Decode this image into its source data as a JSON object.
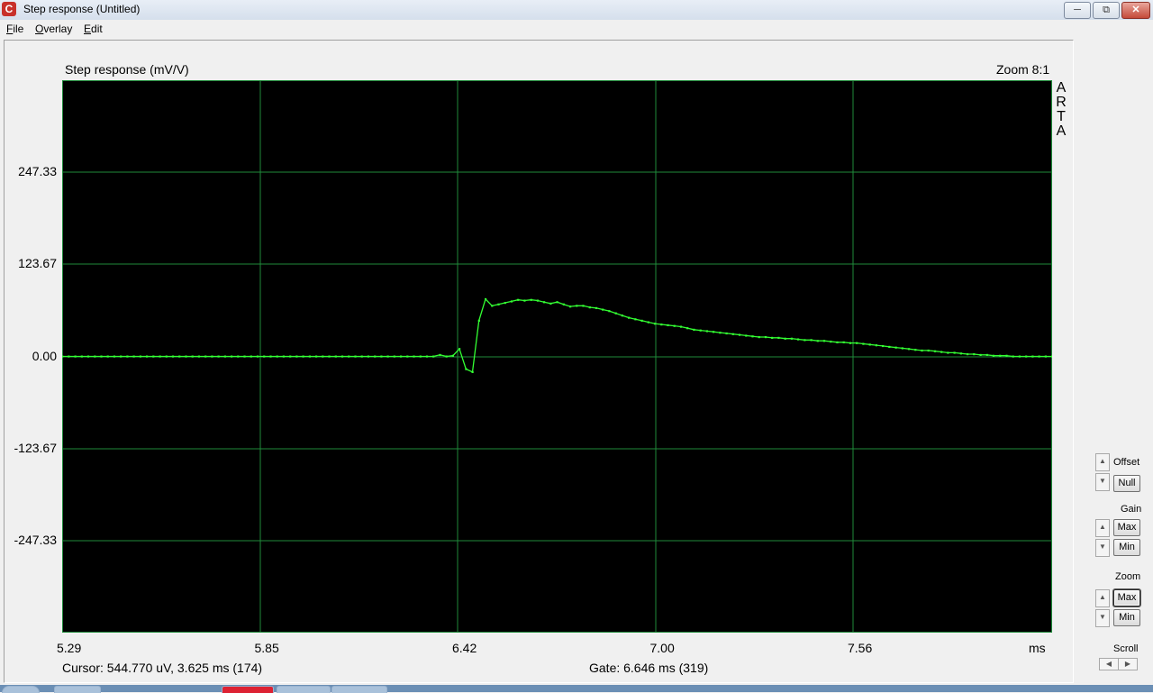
{
  "window": {
    "title": "Step response (Untitled)",
    "icon": "app-icon"
  },
  "menu": [
    "File",
    "Overlay",
    "Edit"
  ],
  "graph": {
    "title": "Step response (mV/V)",
    "zoom": "Zoom 8:1",
    "watermark": "ARTA",
    "x_unit": "ms",
    "cursor": "Cursor: 544.770 uV,    3.625 ms  (174)",
    "gate": "Gate:    6.646 ms  (319)"
  },
  "controls": {
    "offset_label": "Offset",
    "null_label": "Null",
    "gain_label": "Gain",
    "gain_max": "Max",
    "gain_min": "Min",
    "zoom_label": "Zoom",
    "zoom_max": "Max",
    "zoom_min": "Min",
    "scroll_label": "Scroll"
  },
  "colors": {
    "plot_bg": "#000000",
    "grid": "#1f8a3a",
    "trace": "#33ff33"
  },
  "chart_data": {
    "type": "line",
    "title": "Step response (mV/V)",
    "xlabel": "ms",
    "ylabel": "",
    "xlim": [
      5.29,
      7.0
    ],
    "ylim": [
      -371,
      371
    ],
    "x_ticks": [
      "5.29",
      "5.85",
      "6.42",
      "7.00",
      "7.56"
    ],
    "y_ticks": [
      "247.33",
      "123.67",
      "0.00",
      "-123.67",
      "-247.33"
    ],
    "x_tick_values": [
      5.29,
      5.85,
      6.42,
      7.0,
      7.56
    ],
    "y_tick_values": [
      247.33,
      123.67,
      0.0,
      -123.67,
      -247.33
    ],
    "grid": true,
    "series": [
      {
        "x": [
          5.29,
          5.308,
          5.326,
          5.343,
          5.361,
          5.379,
          5.397,
          5.414,
          5.432,
          5.45,
          5.468,
          5.486,
          5.503,
          5.521,
          5.539,
          5.557,
          5.575,
          5.592,
          5.61,
          5.628,
          5.646,
          5.664,
          5.681,
          5.699,
          5.717,
          5.735,
          5.753,
          5.77,
          5.788,
          5.806,
          5.824,
          5.842,
          5.859,
          5.877,
          5.895,
          5.913,
          5.931,
          5.948,
          5.966,
          5.984,
          6.002,
          6.02,
          6.037,
          6.055,
          6.073,
          6.091,
          6.109,
          6.126,
          6.144,
          6.162,
          6.18,
          6.198,
          6.215,
          6.233,
          6.251,
          6.269,
          6.287,
          6.304,
          6.322,
          6.34,
          6.358,
          6.376,
          6.393,
          6.411,
          6.429,
          6.447,
          6.465,
          6.482,
          6.5,
          6.518,
          6.536,
          6.554,
          6.571,
          6.589,
          6.607,
          6.625,
          6.643,
          6.66,
          6.678,
          6.696,
          6.714,
          6.732,
          6.749,
          6.767,
          6.785,
          6.803,
          6.821,
          6.838,
          6.856,
          6.874,
          6.892,
          6.91,
          6.927,
          6.945,
          6.963,
          6.981,
          6.999,
          7.016,
          7.034,
          7.052,
          7.07,
          7.088,
          7.105,
          7.123,
          7.141,
          7.159,
          7.177,
          7.194,
          7.212,
          7.23,
          7.248,
          7.266,
          7.283,
          7.301,
          7.319,
          7.337,
          7.355,
          7.372,
          7.39,
          7.408,
          7.426,
          7.444,
          7.461,
          7.479,
          7.497,
          7.515,
          7.533,
          7.55,
          7.568,
          7.586,
          7.604,
          7.622,
          7.639,
          7.657,
          7.675,
          7.693,
          7.711,
          7.728,
          7.746,
          7.764,
          7.782,
          7.8,
          7.817,
          7.835,
          7.853,
          7.871,
          7.889,
          7.906,
          7.924,
          7.942,
          7.96,
          7.978,
          7.996
        ],
        "values": [
          0,
          0,
          0,
          0,
          0,
          0,
          0,
          0,
          0,
          0,
          0,
          0,
          0,
          0,
          0,
          0,
          0,
          0,
          0,
          0,
          0,
          0,
          0,
          0,
          0,
          0,
          0,
          0,
          0,
          0,
          0,
          0,
          0,
          0,
          0,
          0,
          0,
          0,
          0,
          0,
          0,
          0,
          0,
          0,
          0,
          0,
          0,
          0,
          0,
          0,
          0,
          0,
          0,
          0,
          0,
          0,
          0,
          0,
          2,
          0,
          1,
          10,
          -17,
          -21,
          48,
          77,
          68,
          70,
          72,
          74,
          76,
          75,
          76,
          75,
          73,
          71,
          73,
          70,
          67,
          68,
          68,
          66,
          65,
          63,
          61,
          58,
          55,
          52,
          50,
          48,
          46,
          44,
          43,
          42,
          41,
          40,
          38,
          36,
          35,
          34,
          33,
          32,
          31,
          30,
          29,
          28,
          27,
          26,
          26,
          25,
          25,
          24,
          24,
          23,
          22,
          22,
          21,
          21,
          20,
          19,
          19,
          18,
          18,
          17,
          16,
          15,
          14,
          13,
          12,
          11,
          10,
          9,
          8,
          8,
          7,
          6,
          5,
          5,
          4,
          3,
          3,
          2,
          2,
          1,
          1,
          1,
          0,
          0,
          0,
          0,
          0,
          0,
          0
        ]
      }
    ]
  }
}
